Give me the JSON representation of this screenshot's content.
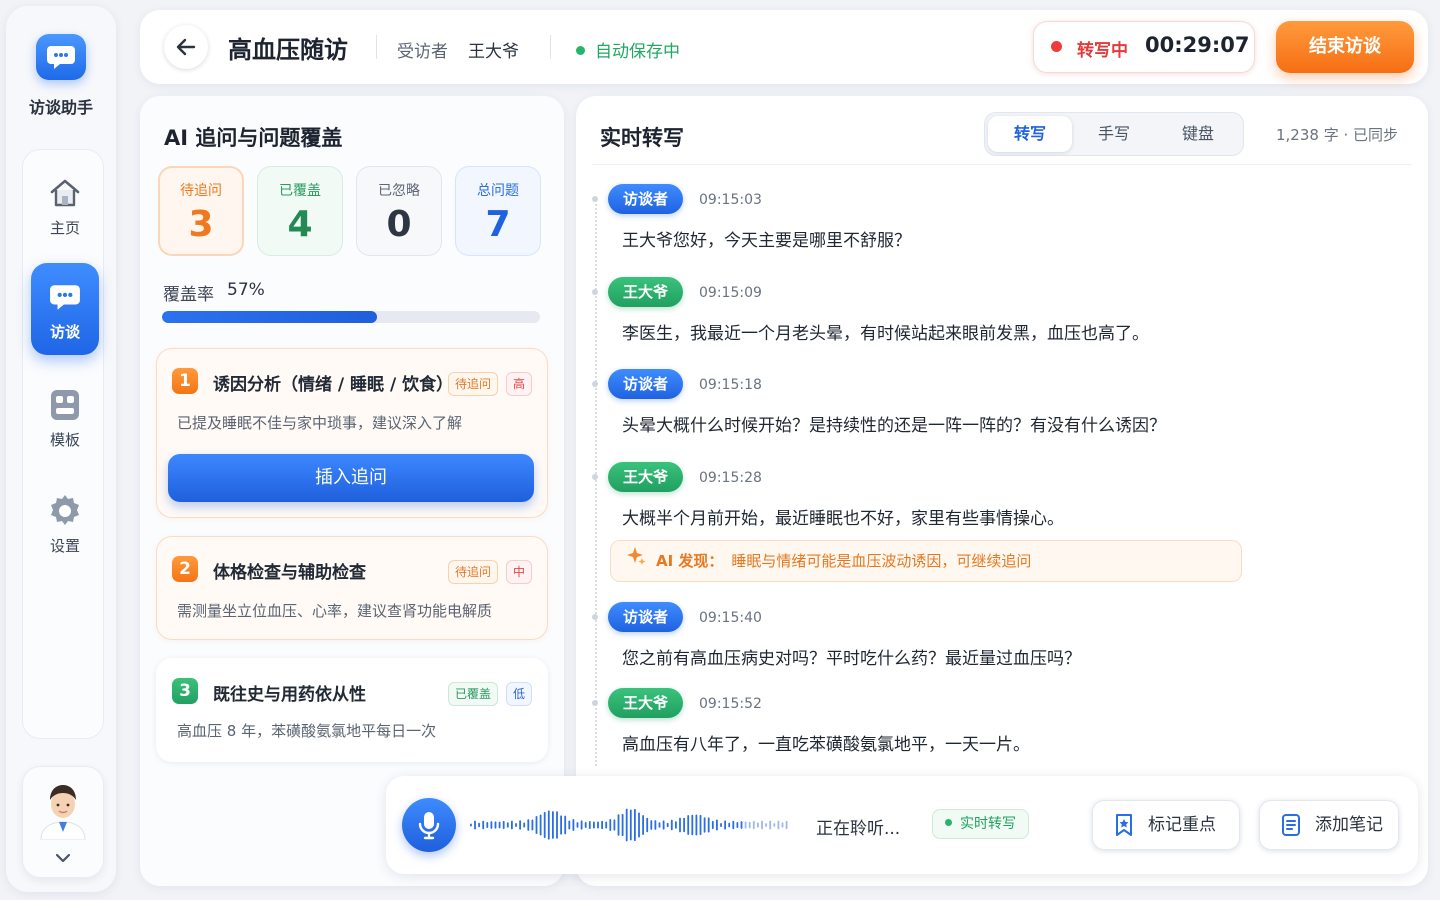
{
  "app": {
    "name": "访谈助手",
    "nav": [
      {
        "label": "主页",
        "icon": "home-icon",
        "active": false
      },
      {
        "label": "访谈",
        "icon": "chat-icon",
        "active": true
      },
      {
        "label": "模板",
        "icon": "template-icon",
        "active": false
      },
      {
        "label": "设置",
        "icon": "gear-icon",
        "active": false
      }
    ]
  },
  "header": {
    "title": "高血压随访",
    "interviewee_label": "受访者",
    "interviewee_name": "王大爷",
    "autosave": "自动保存中",
    "recording_label": "转写中",
    "recording_time": "00:29:07",
    "end_button": "结束访谈"
  },
  "coverage": {
    "title": "AI 追问与问题覆盖",
    "stats": {
      "pending": {
        "label": "待追问",
        "value": "3"
      },
      "covered": {
        "label": "已覆盖",
        "value": "4"
      },
      "ignored": {
        "label": "已忽略",
        "value": "0"
      },
      "total": {
        "label": "总问题",
        "value": "7"
      }
    },
    "rate_label": "覆盖率",
    "rate_value": "57%",
    "rate_fraction": 0.57,
    "questions": [
      {
        "num": "1",
        "title": "诱因分析（情绪 / 睡眠 / 饮食）",
        "status": "待追问",
        "priority": "高",
        "desc": "已提及睡眠不佳与家中琐事，建议深入了解",
        "action": "插入追问"
      },
      {
        "num": "2",
        "title": "体格检查与辅助检查",
        "status": "待追问",
        "priority": "中",
        "desc": "需测量坐立位血压、心率，建议查肾功能电解质"
      },
      {
        "num": "3",
        "title": "既往史与用药依从性",
        "status": "已覆盖",
        "priority": "低",
        "desc": "高血压 8 年，苯磺酸氨氯地平每日一次"
      }
    ]
  },
  "transcript": {
    "title": "实时转写",
    "tabs": [
      "转写",
      "手写",
      "键盘"
    ],
    "active_tab": "转写",
    "word_count": "1,238 字 · 已同步",
    "messages": [
      {
        "speaker": "访谈者",
        "time": "09:15:03",
        "text": "王大爷您好，今天主要是哪里不舒服？"
      },
      {
        "speaker": "王大爷",
        "time": "09:15:09",
        "text": "李医生，我最近一个月老头晕，有时候站起来眼前发黑，血压也高了。"
      },
      {
        "speaker": "访谈者",
        "time": "09:15:18",
        "text": "头晕大概什么时候开始？是持续性的还是一阵一阵的？有没有什么诱因？"
      },
      {
        "speaker": "王大爷",
        "time": "09:15:28",
        "text": "大概半个月前开始，最近睡眠也不好，家里有些事情操心。"
      },
      {
        "speaker": "访谈者",
        "time": "09:15:40",
        "text": "您之前有高血压病史对吗？平时吃什么药？最近量过血压吗？"
      },
      {
        "speaker": "王大爷",
        "time": "09:15:52",
        "text": "高血压有八年了，一直吃苯磺酸氨氯地平，一天一片。"
      }
    ],
    "ai_note_prefix": "AI 发现：",
    "ai_note": "睡眠与情绪可能是血压波动诱因，可继续追问"
  },
  "bottom": {
    "listening": "正在聆听...",
    "realtime": "实时转写",
    "mark_button": "标记重点",
    "note_button": "添加笔记"
  },
  "colors": {
    "primary": "#1f62e0",
    "accent_orange": "#f66e13",
    "success_green": "#22a863",
    "danger_red": "#ef3b3b"
  }
}
